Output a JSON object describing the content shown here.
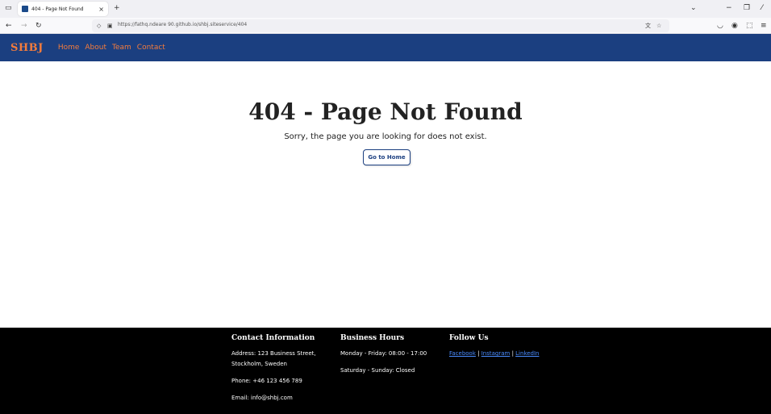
{
  "browser": {
    "tab_title": "404 - Page Not Found",
    "tab_close": "×",
    "new_tab": "+",
    "list_all_tabs": "⌄",
    "minimize": "−",
    "restore": "❐",
    "close_window": "⁄",
    "url": "https://fathq.ndeare 90.github.io/shbj.siteservice/404",
    "icons": [
      "sidebar-icon",
      "back-arrow-icon",
      "forward-arrow-icon",
      "reload-icon",
      "shield-icon",
      "lock-icon",
      "translate-icon",
      "star-icon",
      "pocket-icon",
      "account-icon",
      "extensions-icon",
      "menu-icon"
    ]
  },
  "site": {
    "logo": "SHBJ",
    "nav": [
      "Home",
      "About",
      "Team",
      "Contact"
    ],
    "colors": {
      "header": "#1b3f80",
      "accent": "#f47c3c",
      "link": "#4a8cff",
      "footer": "#000000"
    }
  },
  "main": {
    "title": "404 - Page Not Found",
    "message": "Sorry, the page you are looking for does not exist.",
    "button": "Go to Home"
  },
  "footer": {
    "contact": {
      "heading": "Contact Information",
      "address_line1": "Address: 123 Business Street,",
      "address_line2": "Stockholm, Sweden",
      "phone": "Phone: +46 123 456 789",
      "email": "Email: info@shbj.com"
    },
    "hours": {
      "heading": "Business Hours",
      "weekdays": "Monday - Friday: 08:00 - 17:00",
      "weekend": "Saturday - Sunday: Closed"
    },
    "follow": {
      "heading": "Follow Us",
      "links": [
        "Facebook",
        "Instagram",
        "LinkedIn"
      ],
      "separator": " | "
    }
  }
}
